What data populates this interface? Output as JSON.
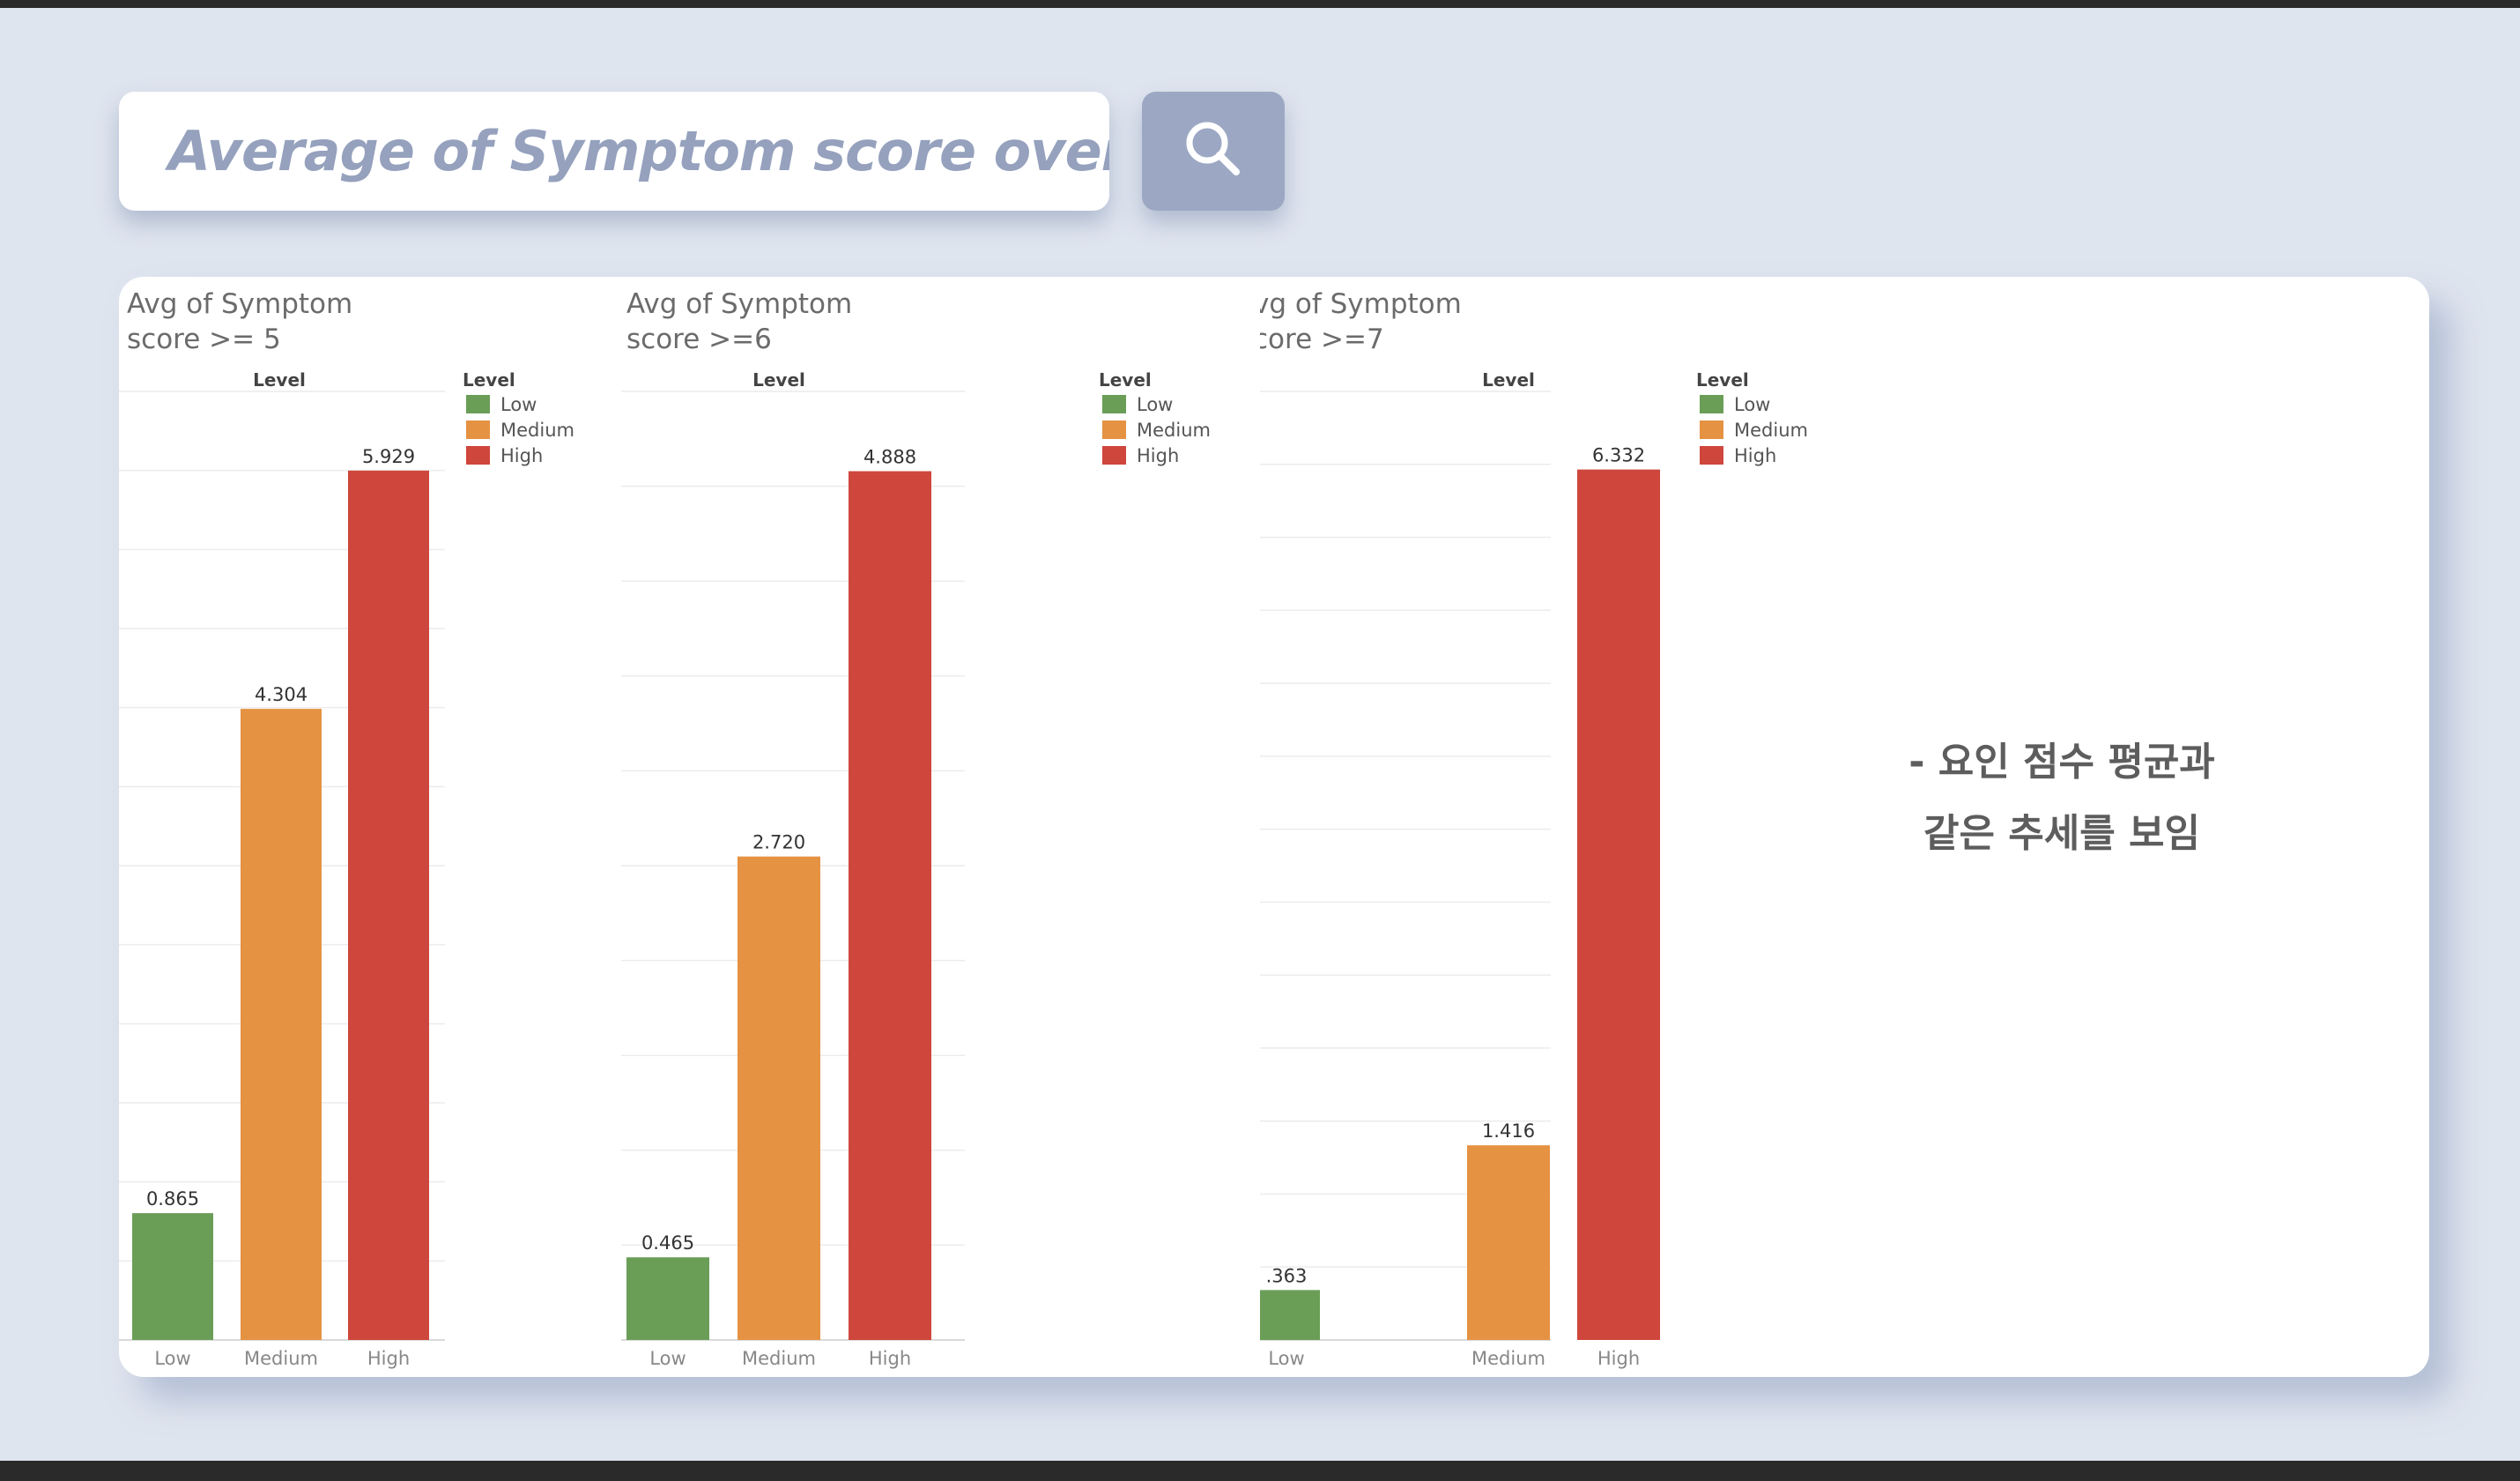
{
  "search": {
    "text": "Average of Symptom score over N",
    "button_icon": "search-icon"
  },
  "chart_data": [
    {
      "type": "bar",
      "title_line1": "Avg of Symptom",
      "title_line2": "score >= 5",
      "xlabel": "Level",
      "categories": [
        "Low",
        "Medium",
        "High"
      ],
      "values": [
        0.865,
        4.304,
        5.929
      ],
      "value_labels": [
        "0.865",
        "4.304",
        "5.929"
      ],
      "ylim": [
        0,
        6.0
      ],
      "gridline_count": 12,
      "legend": {
        "title": "Level",
        "entries": [
          "Low",
          "Medium",
          "High"
        ],
        "position": "top-right"
      },
      "colors": [
        "#6a9e57",
        "#e59243",
        "#cf463c"
      ]
    },
    {
      "type": "bar",
      "title_line1": "Avg of Symptom",
      "title_line2": "score >=6",
      "xlabel": "Level",
      "categories": [
        "Low",
        "Medium",
        "High"
      ],
      "values": [
        0.465,
        2.72,
        4.888
      ],
      "value_labels": [
        "0.465",
        "2.720",
        "4.888"
      ],
      "ylim": [
        0,
        4.95
      ],
      "gridline_count": 10,
      "legend": {
        "title": "Level",
        "entries": [
          "Low",
          "Medium",
          "High"
        ],
        "position": "top-right"
      },
      "colors": [
        "#6a9e57",
        "#e59243",
        "#cf463c"
      ]
    },
    {
      "type": "bar",
      "title_line1": "vg of Symptom",
      "title_line2": "core >=7",
      "xlabel": "Level",
      "categories": [
        "Low",
        "Medium",
        "High"
      ],
      "values": [
        0.363,
        1.416,
        6.332
      ],
      "value_labels": [
        ".363",
        "1.416",
        "6.332"
      ],
      "ylim": [
        0,
        6.4
      ],
      "gridline_count": 13,
      "legend": {
        "title": "Level",
        "entries": [
          "Low",
          "Medium",
          "High"
        ],
        "position": "top-right"
      },
      "colors": [
        "#6a9e57",
        "#e59243",
        "#cf463c"
      ]
    }
  ],
  "note": {
    "line1": "- 요인 점수 평균과",
    "line2": "같은 추세를 보임"
  }
}
